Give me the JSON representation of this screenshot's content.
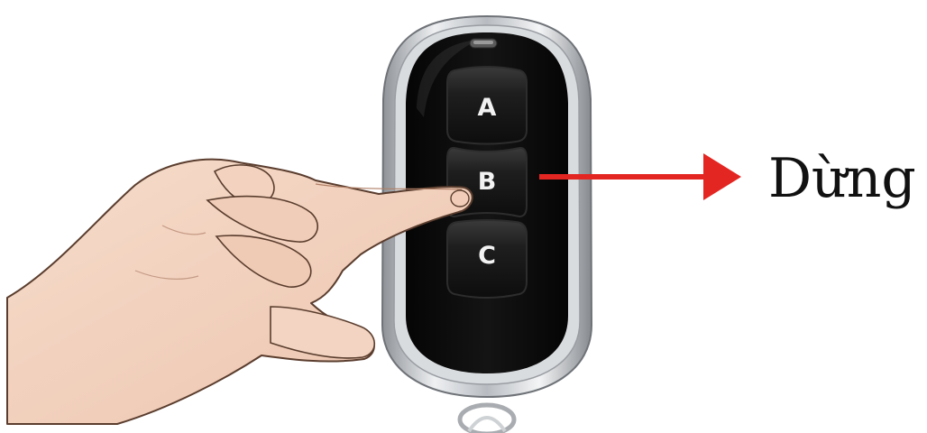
{
  "remote": {
    "buttons": [
      {
        "label": "A"
      },
      {
        "label": "B"
      },
      {
        "label": "C"
      }
    ],
    "pressed_button": "B"
  },
  "result": {
    "label": "Dừng"
  },
  "colors": {
    "arrow": "#e32622",
    "remote_body": "#0b0b0b",
    "button_face": "#1c1c1c",
    "chrome_frame": "#c9ccd1",
    "skin": "#f2d2c0",
    "background": "#ffffff"
  },
  "icons": [
    "hand-pointing-icon",
    "arrow-right-icon",
    "led-indicator-icon",
    "keyring-icon"
  ]
}
